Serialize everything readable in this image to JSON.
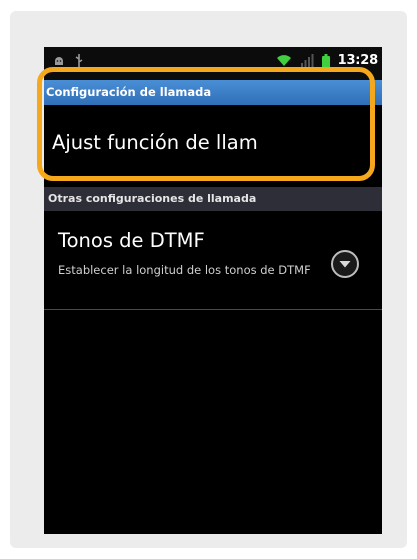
{
  "status_bar": {
    "time": "13:28",
    "icons": [
      "android-debug-icon",
      "usb-icon",
      "wifi-icon",
      "signal-icon",
      "battery-icon"
    ]
  },
  "title_bar": {
    "title": "Configuración de llamada"
  },
  "main_item": {
    "label": "Ajust función de llam"
  },
  "section": {
    "header": "Otras configuraciones de llamada"
  },
  "dtmf_item": {
    "title": "Tonos de DTMF",
    "summary": "Establecer la longitud de los tonos de DTMF",
    "icon": "chevron-down-circle-icon"
  },
  "colors": {
    "highlight": "#f5a81c",
    "title_bar": "#3b7dc8",
    "section_bg": "#2e2e38",
    "screen_bg": "#000000"
  }
}
